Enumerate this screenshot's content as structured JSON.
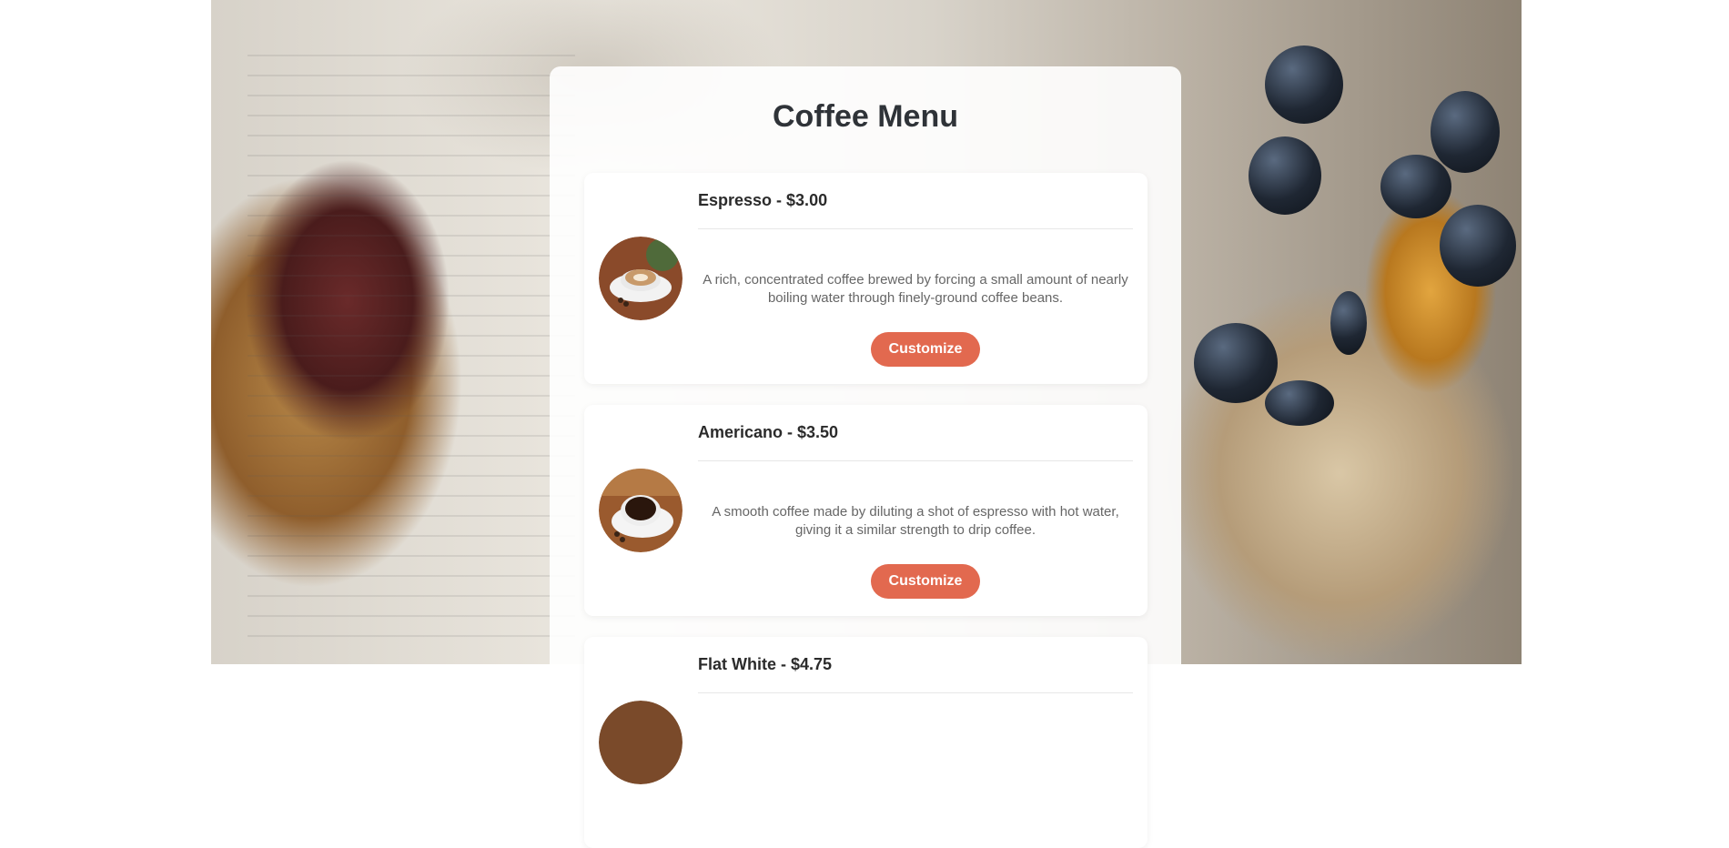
{
  "page": {
    "title": "Coffee Menu"
  },
  "colors": {
    "accent": "#e2694f",
    "title_text": "#2f3338",
    "description_text": "#666666"
  },
  "menu_items": [
    {
      "name_price": "Espresso - $3.00",
      "description": "A rich, concentrated coffee brewed by forcing a small amount of nearly boiling water through finely-ground coffee beans.",
      "button_label": "Customize",
      "image": "latte-art-cup-photo"
    },
    {
      "name_price": "Americano - $3.50",
      "description": "A smooth coffee made by diluting a shot of espresso with hot water, giving it a similar strength to drip coffee.",
      "button_label": "Customize",
      "image": "black-coffee-cup-photo"
    },
    {
      "name_price": "Flat White - $4.75",
      "image": "coffee-cup-photo"
    }
  ]
}
